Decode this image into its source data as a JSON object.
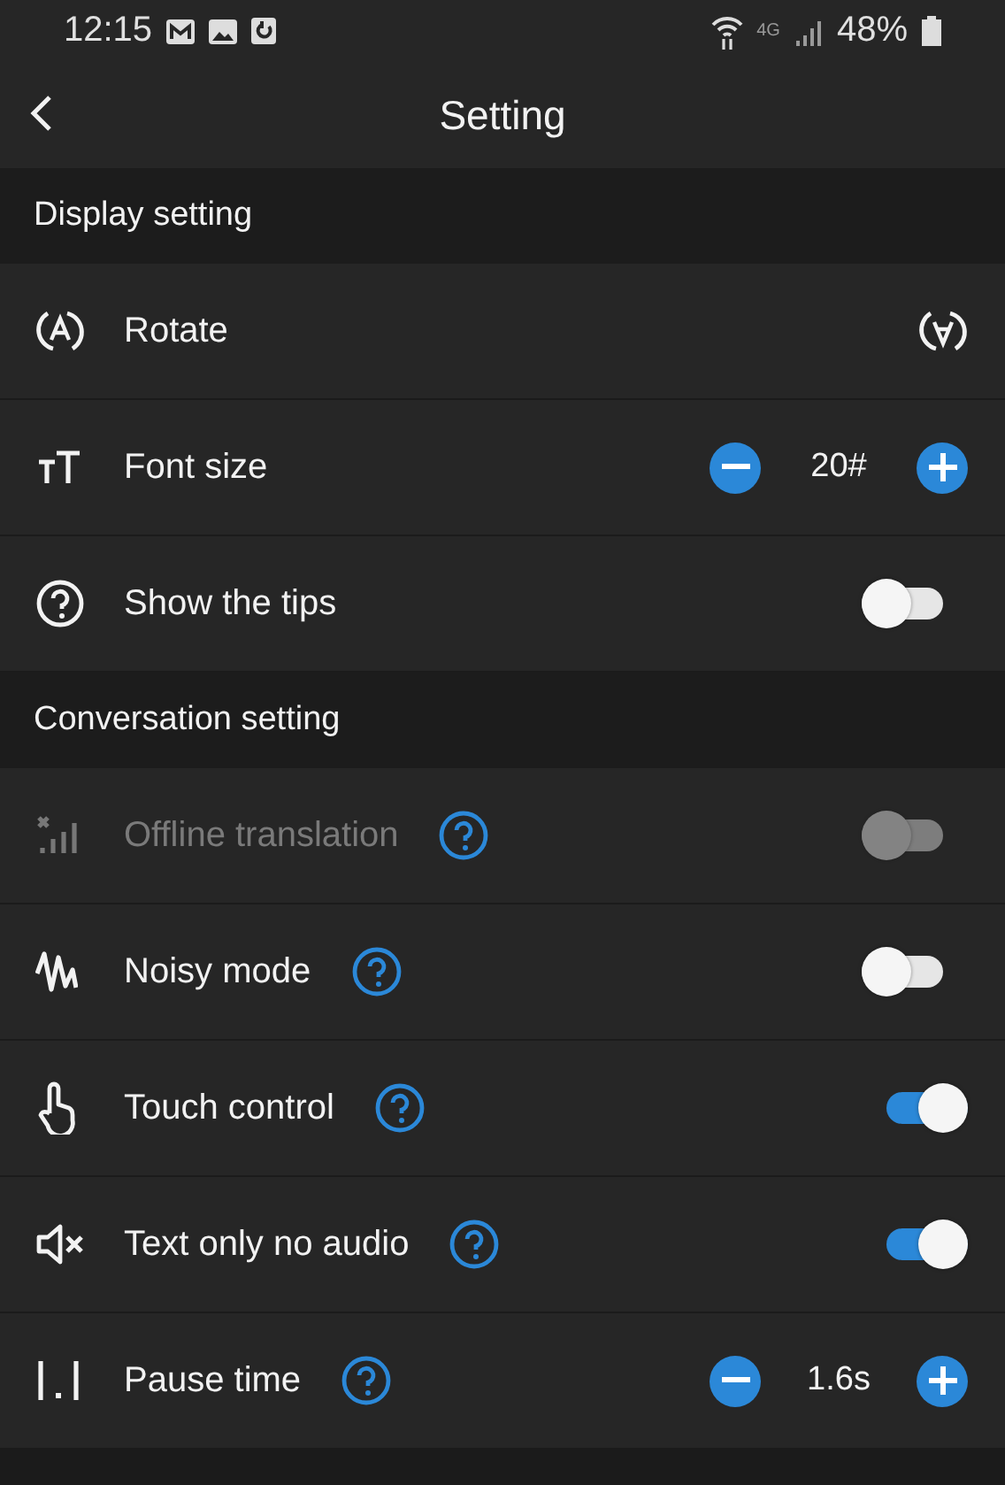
{
  "status_bar": {
    "time": "12:15",
    "network": "4G",
    "battery": "48%"
  },
  "header": {
    "title": "Setting"
  },
  "sections": [
    {
      "title": "Display setting",
      "rows": [
        {
          "kind": "action",
          "label": "Rotate",
          "help": false
        },
        {
          "kind": "stepper",
          "label": "Font size",
          "value": "20#",
          "help": false
        },
        {
          "kind": "toggle",
          "label": "Show the tips",
          "help": false,
          "on": false,
          "disabled": false
        }
      ]
    },
    {
      "title": "Conversation setting",
      "rows": [
        {
          "kind": "toggle",
          "label": "Offline translation",
          "help": true,
          "on": false,
          "disabled": true
        },
        {
          "kind": "toggle",
          "label": "Noisy mode",
          "help": true,
          "on": false,
          "disabled": false
        },
        {
          "kind": "toggle",
          "label": "Touch control",
          "help": true,
          "on": true,
          "disabled": false
        },
        {
          "kind": "toggle",
          "label": "Text only no audio",
          "help": true,
          "on": true,
          "disabled": false
        },
        {
          "kind": "stepper",
          "label": "Pause time",
          "value": "1.6s",
          "help": true
        }
      ]
    }
  ]
}
